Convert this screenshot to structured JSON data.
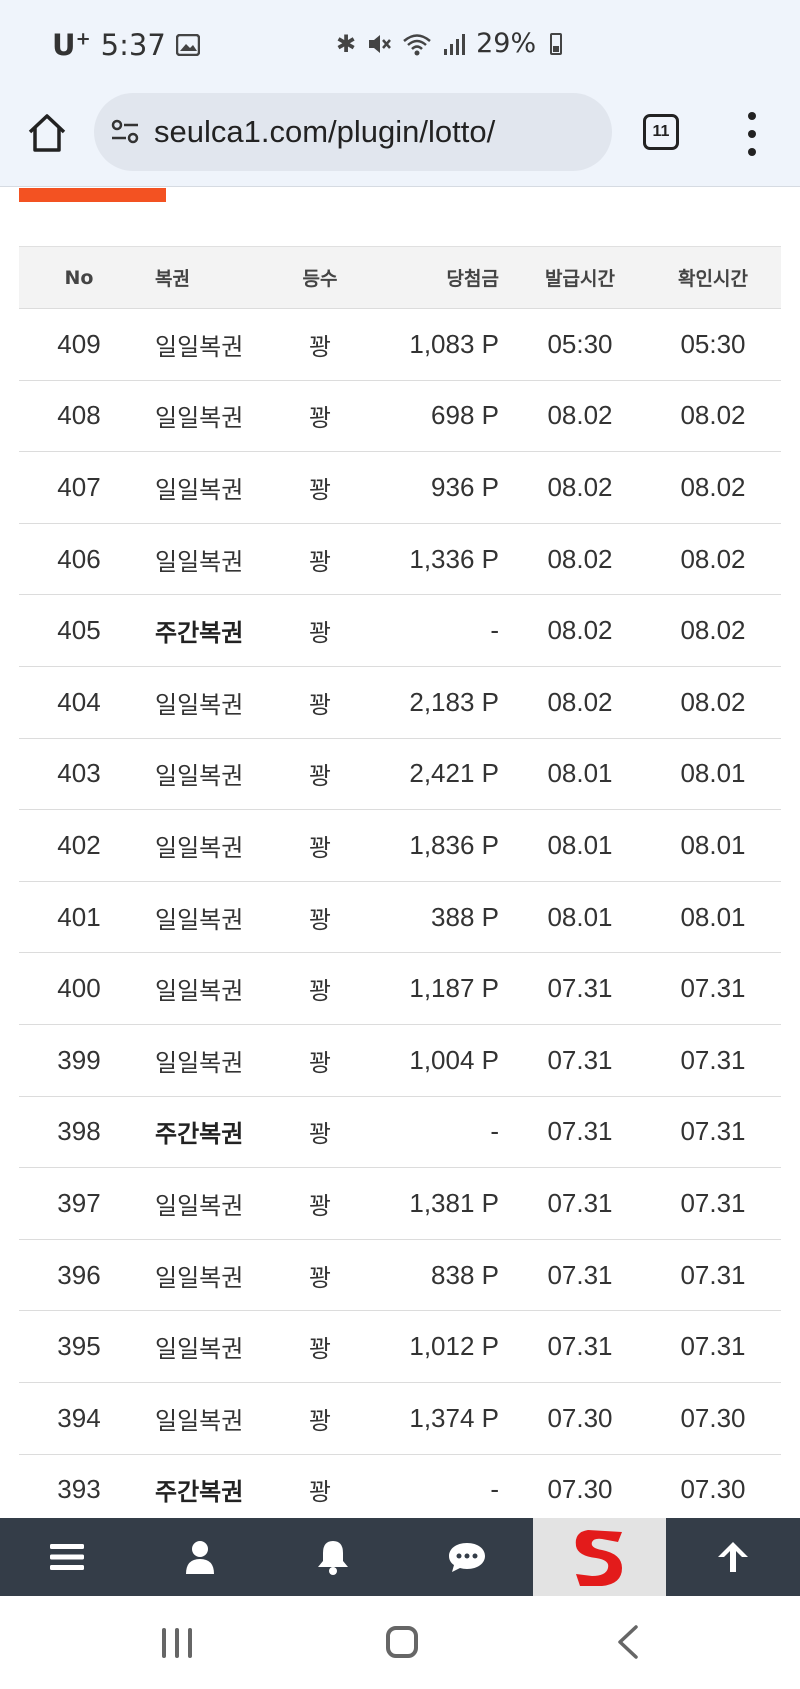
{
  "status_bar": {
    "carrier": "U",
    "carrier_sup": "+",
    "time": "5:37",
    "battery": "29%"
  },
  "browser": {
    "url": "seulca1.com/plugin/lotto/",
    "tab_count": "11"
  },
  "table": {
    "headers": {
      "no": "No",
      "type": "복권",
      "rank": "등수",
      "prize": "당첨금",
      "issued": "발급시간",
      "checked": "확인시간"
    },
    "rows": [
      {
        "no": "409",
        "type": "일일복권",
        "bold": false,
        "rank": "꽝",
        "prize": "1,083 P",
        "issued": "05:30",
        "checked": "05:30"
      },
      {
        "no": "408",
        "type": "일일복권",
        "bold": false,
        "rank": "꽝",
        "prize": "698 P",
        "issued": "08.02",
        "checked": "08.02"
      },
      {
        "no": "407",
        "type": "일일복권",
        "bold": false,
        "rank": "꽝",
        "prize": "936 P",
        "issued": "08.02",
        "checked": "08.02"
      },
      {
        "no": "406",
        "type": "일일복권",
        "bold": false,
        "rank": "꽝",
        "prize": "1,336 P",
        "issued": "08.02",
        "checked": "08.02"
      },
      {
        "no": "405",
        "type": "주간복권",
        "bold": true,
        "rank": "꽝",
        "prize": "-",
        "issued": "08.02",
        "checked": "08.02"
      },
      {
        "no": "404",
        "type": "일일복권",
        "bold": false,
        "rank": "꽝",
        "prize": "2,183 P",
        "issued": "08.02",
        "checked": "08.02"
      },
      {
        "no": "403",
        "type": "일일복권",
        "bold": false,
        "rank": "꽝",
        "prize": "2,421 P",
        "issued": "08.01",
        "checked": "08.01"
      },
      {
        "no": "402",
        "type": "일일복권",
        "bold": false,
        "rank": "꽝",
        "prize": "1,836 P",
        "issued": "08.01",
        "checked": "08.01"
      },
      {
        "no": "401",
        "type": "일일복권",
        "bold": false,
        "rank": "꽝",
        "prize": "388 P",
        "issued": "08.01",
        "checked": "08.01"
      },
      {
        "no": "400",
        "type": "일일복권",
        "bold": false,
        "rank": "꽝",
        "prize": "1,187 P",
        "issued": "07.31",
        "checked": "07.31"
      },
      {
        "no": "399",
        "type": "일일복권",
        "bold": false,
        "rank": "꽝",
        "prize": "1,004 P",
        "issued": "07.31",
        "checked": "07.31"
      },
      {
        "no": "398",
        "type": "주간복권",
        "bold": true,
        "rank": "꽝",
        "prize": "-",
        "issued": "07.31",
        "checked": "07.31"
      },
      {
        "no": "397",
        "type": "일일복권",
        "bold": false,
        "rank": "꽝",
        "prize": "1,381 P",
        "issued": "07.31",
        "checked": "07.31"
      },
      {
        "no": "396",
        "type": "일일복권",
        "bold": false,
        "rank": "꽝",
        "prize": "838 P",
        "issued": "07.31",
        "checked": "07.31"
      },
      {
        "no": "395",
        "type": "일일복권",
        "bold": false,
        "rank": "꽝",
        "prize": "1,012 P",
        "issued": "07.31",
        "checked": "07.31"
      },
      {
        "no": "394",
        "type": "일일복권",
        "bold": false,
        "rank": "꽝",
        "prize": "1,374 P",
        "issued": "07.30",
        "checked": "07.30"
      },
      {
        "no": "393",
        "type": "주간복권",
        "bold": true,
        "rank": "꽝",
        "prize": "-",
        "issued": "07.30",
        "checked": "07.30"
      }
    ]
  },
  "bottom_nav": {
    "items": [
      "menu-icon",
      "user-icon",
      "bell-icon",
      "chat-icon",
      "site-logo",
      "arrow-up-icon"
    ],
    "logo_letter": "S",
    "logo_color": "#e31b1b"
  },
  "colors": {
    "accent_orange": "#f35222",
    "nav_bg": "#343d48",
    "browser_bg": "#eff4fb"
  }
}
